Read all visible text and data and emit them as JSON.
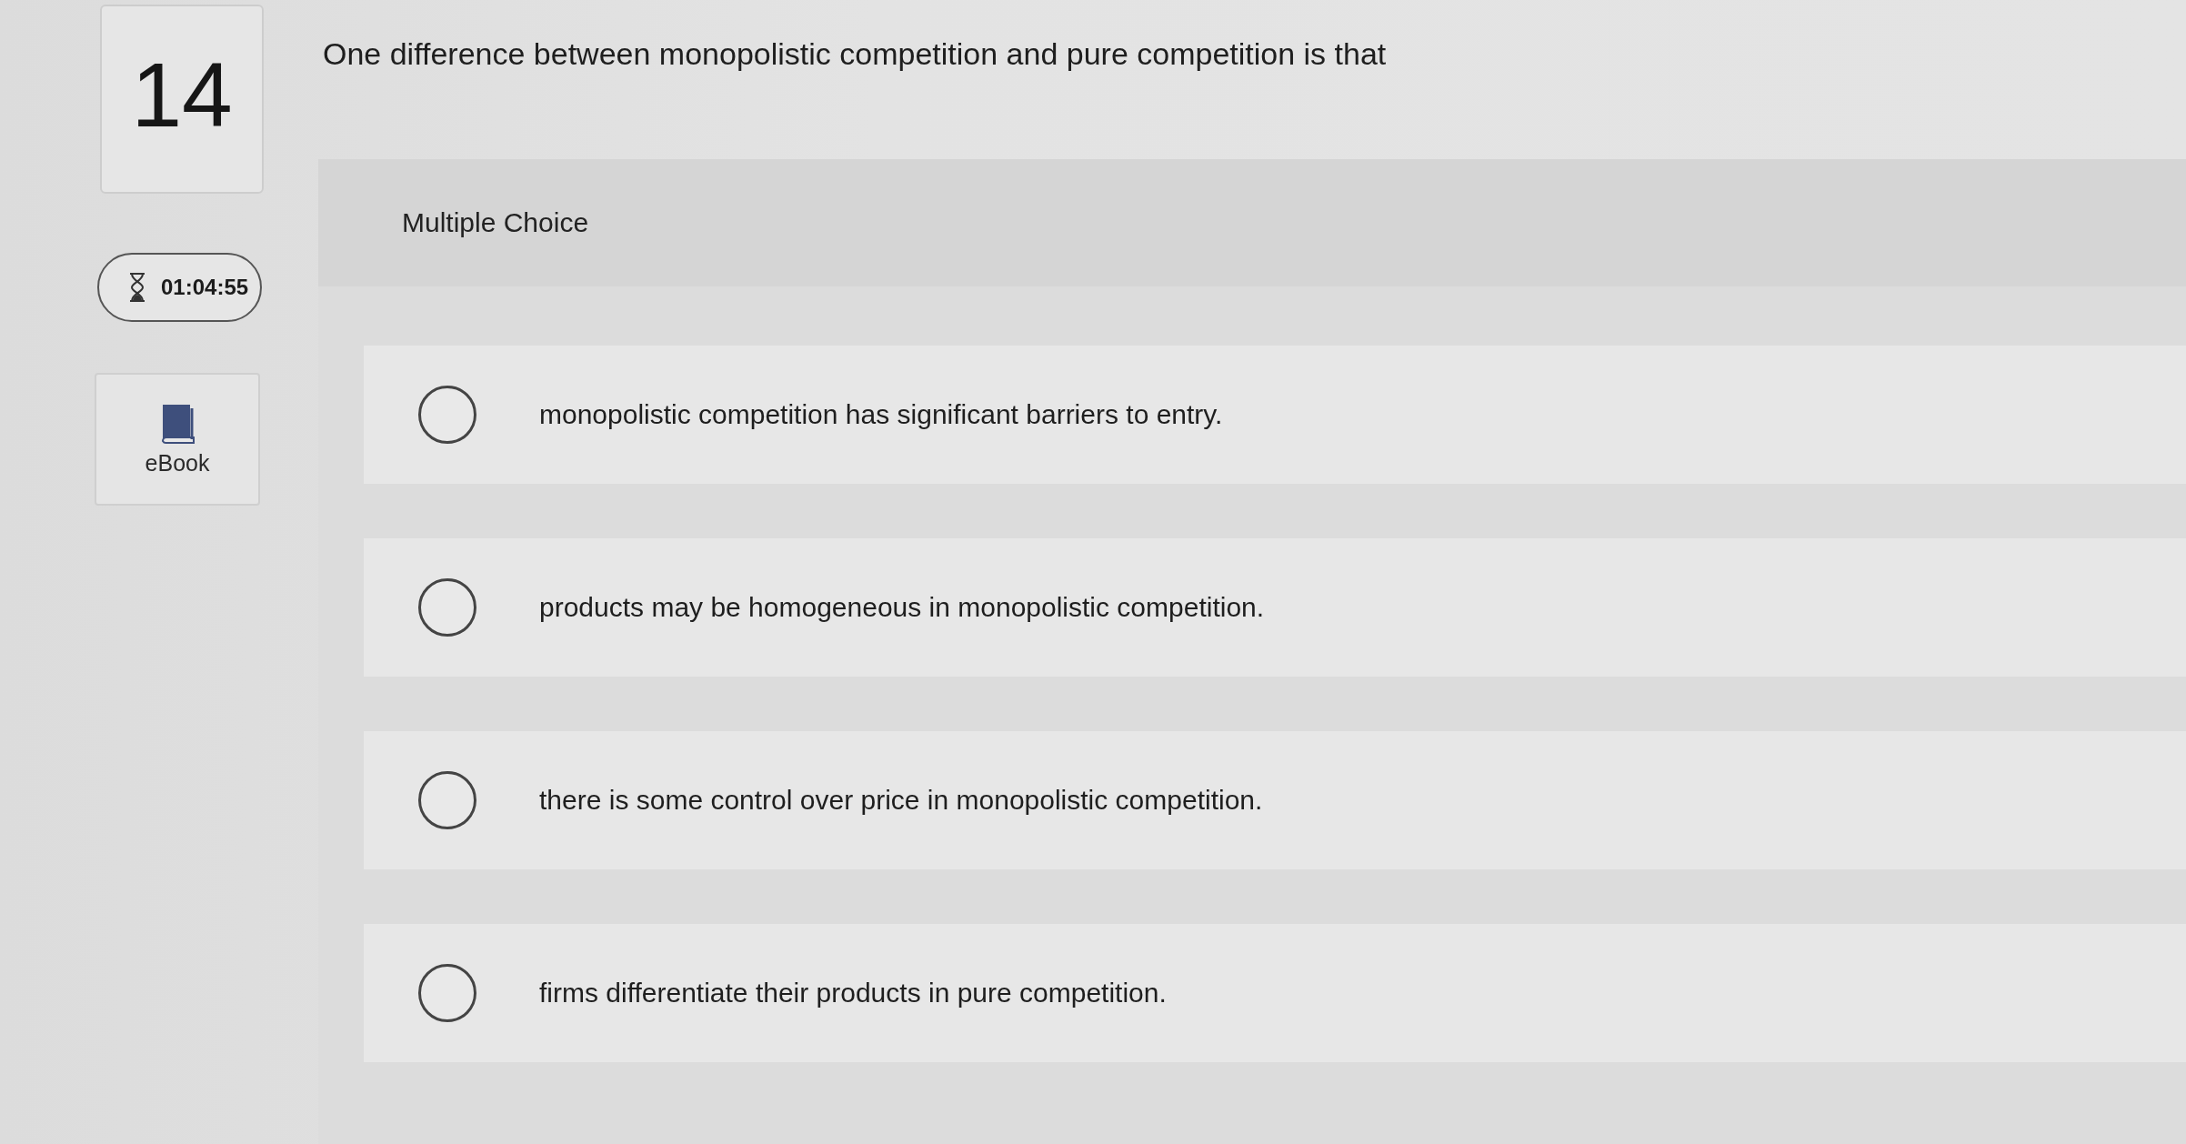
{
  "question": {
    "number": "14",
    "text": "One difference between monopolistic competition and pure competition is that"
  },
  "timer": {
    "time": "01:04:55"
  },
  "ebook": {
    "label": "eBook"
  },
  "answer_panel": {
    "type_label": "Multiple Choice",
    "options": [
      {
        "text": "monopolistic competition has significant barriers to entry.",
        "selected": false
      },
      {
        "text": "products may be homogeneous in monopolistic competition.",
        "selected": false
      },
      {
        "text": "there is some control over price in monopolistic competition.",
        "selected": false
      },
      {
        "text": "firms differentiate their products in pure competition.",
        "selected": false
      }
    ]
  }
}
